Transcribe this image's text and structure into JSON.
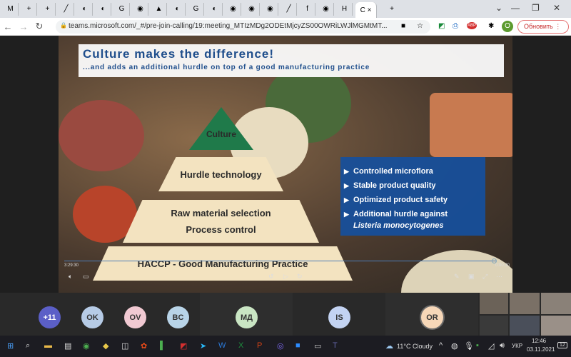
{
  "browser": {
    "tabs": [
      "M",
      "+",
      "+",
      "╱",
      "◐",
      "◐",
      "G",
      "◉",
      "▲",
      "◐",
      "G",
      "◐",
      "◉",
      "◉",
      "◉",
      "╱",
      "f",
      "◉",
      "H"
    ],
    "active_tab": "C",
    "close_tab": "×",
    "new_tab": "+",
    "url": "teams.microsoft.com/_#/pre-join-calling/19:meeting_MTIzMDg2ODEtMjcyZS00OWRiLWJlMGMtMT...",
    "update_button": "Обновить",
    "profile": "O",
    "adblock": "ABP"
  },
  "slide": {
    "title": "Culture makes the difference!",
    "subtitle": "...and adds an additional hurdle on top of a good manufacturing practice",
    "pyramid": [
      "Culture",
      "Hurdle technology",
      "Raw material selection",
      "Process control",
      "HACCP - Good Manufacturing Practice"
    ],
    "bullets": [
      "Controlled microflora",
      "Stable product quality",
      "Optimized  product safety",
      "Additional hurdle against"
    ],
    "bullet_italic": "Listeria monocytogenes"
  },
  "player": {
    "elapsed": "3:29:30",
    "remaining": "0:00:30",
    "progress": 0.99
  },
  "participants": [
    "+11",
    "OK",
    "OV",
    "BC",
    "МД",
    "IS",
    "OR"
  ],
  "taskbar": {
    "weather": "11°C  Cloudy",
    "lang": "УКР",
    "time": "12:46",
    "date": "03.11.2021",
    "notifications": "12"
  }
}
